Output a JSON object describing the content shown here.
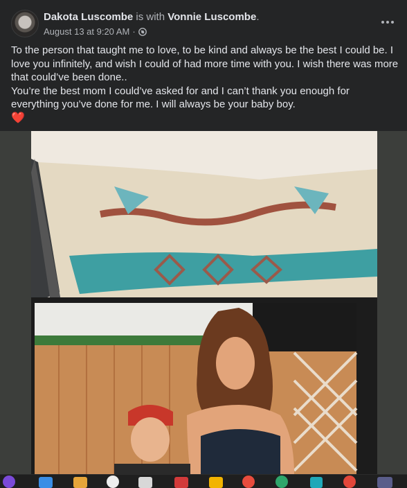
{
  "post": {
    "author": "Dakota Luscombe",
    "with_text": "is with",
    "tagged": "Vonnie Luscombe",
    "period": ".",
    "date": "August 13 at 9:20 AM",
    "separator": "·",
    "privacy_icon": "globe-icon",
    "more_icon": "more-horizontal-icon",
    "text_paragraph_1": "To the person that taught me to love, to be kind and always be the best I could be. I love you infinitely, and wish I could of had more time with you. I wish there was more that could’ve been done..",
    "text_paragraph_2": "You’re the best mom I could’ve asked for and I can’t thank you enough for everything you’ve done for me. I will always be your baby boy.",
    "emoji": "❤️"
  },
  "taskbar": {
    "icons": [
      "twitch-icon",
      "file-explorer-icon",
      "calendar-app-icon",
      "clock-icon",
      "chrome-icon",
      "game-icon",
      "app-icon",
      "google-chrome-icon",
      "edge-icon",
      "teams-icon",
      "chrome-alt-icon",
      "app-badge-icon"
    ]
  },
  "colors": {
    "background": "#242526",
    "text_primary": "#e4e6eb",
    "text_secondary": "#b0b3b8",
    "heart": "#e41e3f",
    "taskbar": "#1f1f1f"
  }
}
